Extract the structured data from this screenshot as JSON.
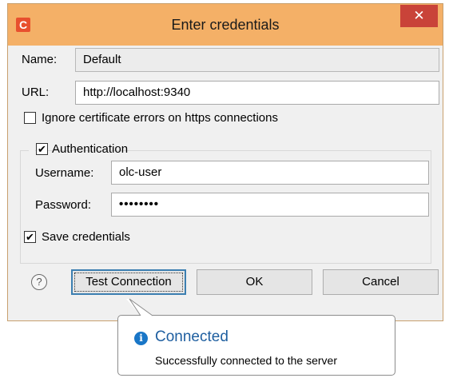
{
  "app_icon": "C",
  "title": "Enter credentials",
  "close_glyph": "✕",
  "name_label": "Name:",
  "name_value": "Default",
  "url_label": "URL:",
  "url_value": "http://localhost:9340",
  "ignore_cert": {
    "label": "Ignore certificate errors on https connections",
    "checked": false
  },
  "auth": {
    "label": "Authentication",
    "checked": true,
    "username_label": "Username:",
    "username_value": "olc-user",
    "password_label": "Password:",
    "password_value": "••••••••"
  },
  "save_credentials": {
    "label": "Save credentials",
    "checked": true
  },
  "help_glyph": "?",
  "buttons": {
    "test": "Test Connection",
    "ok": "OK",
    "cancel": "Cancel"
  },
  "tooltip": {
    "icon": "i",
    "title": "Connected",
    "message": "Successfully connected to the server"
  },
  "check_glyph": "✔"
}
